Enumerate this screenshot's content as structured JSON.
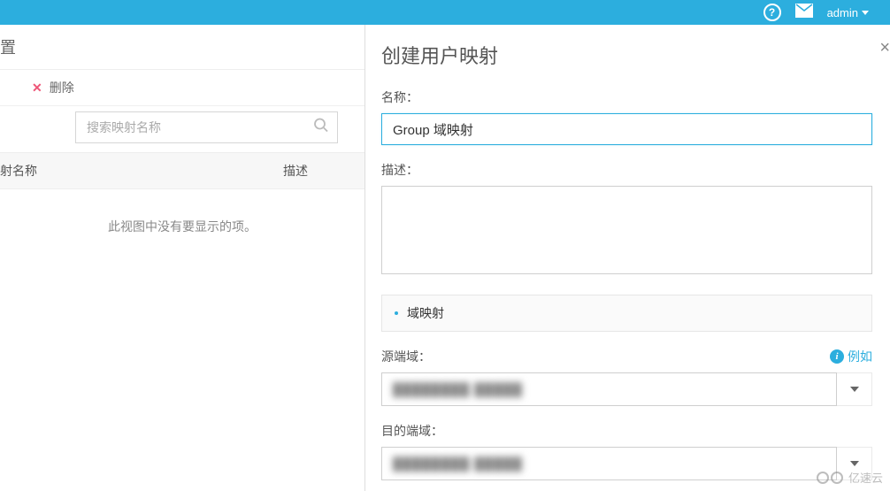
{
  "header": {
    "help_icon": "?",
    "user_name": "admin"
  },
  "left": {
    "page_suffix": "置",
    "delete_label": "删除",
    "search_placeholder": "搜索映射名称",
    "columns": {
      "name": "射名称",
      "desc": "描述"
    },
    "empty_text": "此视图中没有要显示的项。"
  },
  "panel": {
    "title": "创建用户映射",
    "name_label": "名称：",
    "name_value": "Group 域映射",
    "desc_label": "描述：",
    "desc_value": "",
    "section_label": "域映射",
    "source_label": "源端域：",
    "example_label": "例如",
    "target_label": "目的端域：",
    "source_value": "████████ █████",
    "target_value": "████████ █████"
  },
  "watermark": "亿速云"
}
